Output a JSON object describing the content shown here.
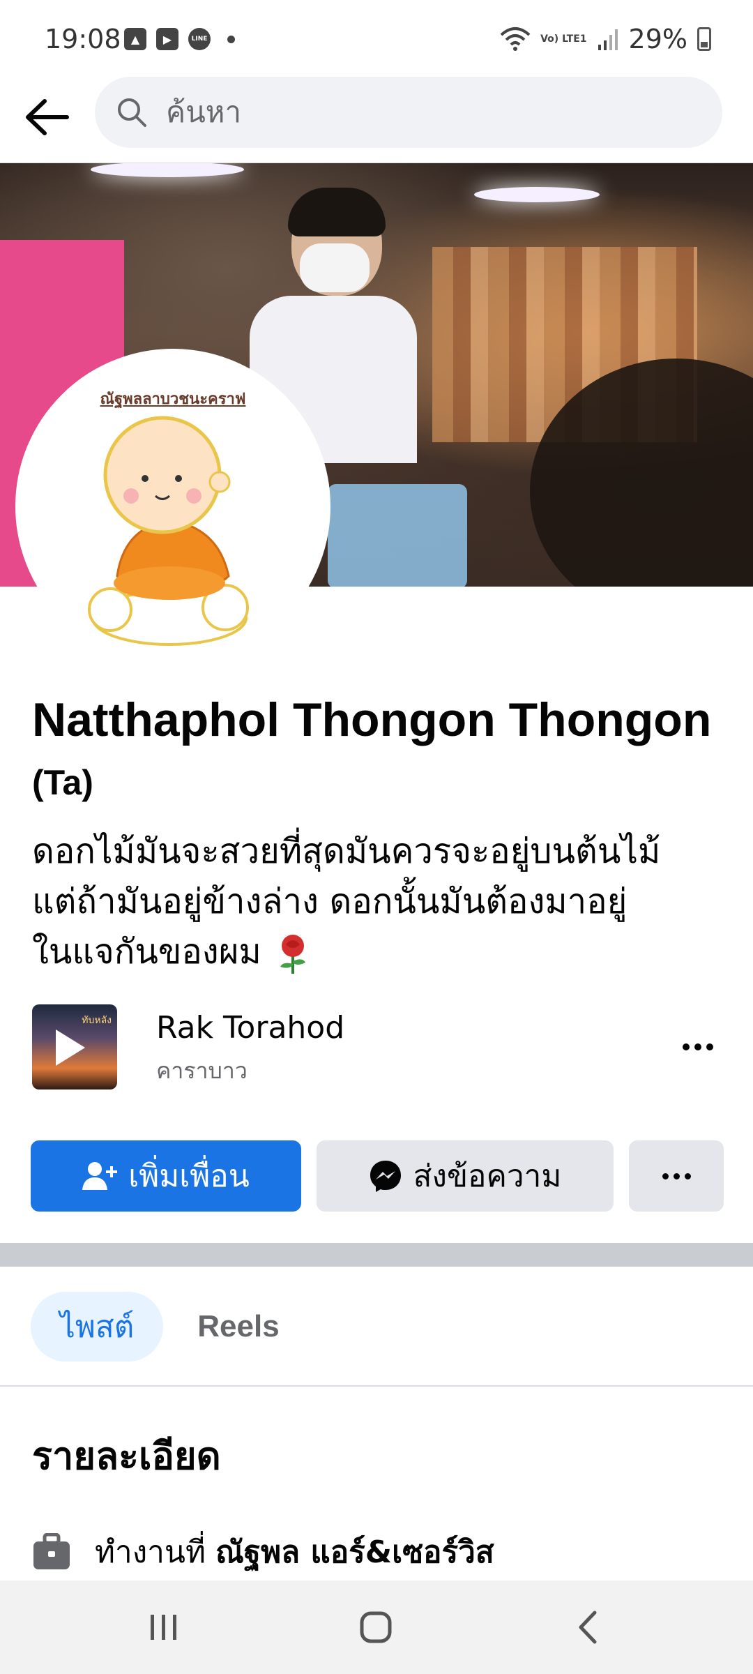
{
  "status_bar": {
    "time": "19:08",
    "battery": "29%",
    "network_label": "Vo) LTE1"
  },
  "search": {
    "placeholder": "ค้นหา"
  },
  "avatar": {
    "title": "ณัฐพลลาบวชนะคราฟ"
  },
  "profile": {
    "name": "Natthaphol Thongon Thongon",
    "nickname": "(Ta)",
    "bio_line1": "ดอกไม้มันจะสวยที่สุดมันควรจะอยู่บนต้นไม้",
    "bio_line2": "แต่ถ้ามันอยู่ข้างล่าง ดอกนั้นมันต้องมาอยู่",
    "bio_line3": "ในแจกันของผม"
  },
  "music": {
    "title": "Rak Torahod",
    "artist": "คาราบาว",
    "thumb_text": "ทับหลัง"
  },
  "actions": {
    "add_friend": "เพิ่มเพื่อน",
    "message": "ส่งข้อความ"
  },
  "tabs": [
    {
      "label": "ไพสต์",
      "active": true
    },
    {
      "label": "Reels",
      "active": false
    }
  ],
  "details": {
    "heading": "รายละเอียด",
    "work_prefix": "ทำงานที่",
    "work_place": "ณัฐพล แอร์&เซอร์วิส"
  },
  "colors": {
    "primary": "#1b74e4",
    "button_gray": "#e4e6eb",
    "active_tab_bg": "#e7f3ff"
  }
}
